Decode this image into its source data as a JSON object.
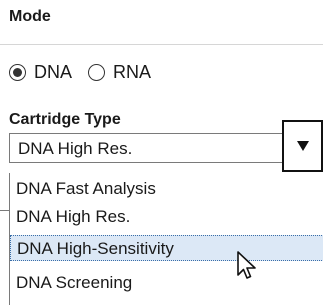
{
  "mode": {
    "title": "Mode",
    "options": [
      {
        "label": "DNA",
        "selected": true
      },
      {
        "label": "RNA",
        "selected": false
      }
    ]
  },
  "cartridge": {
    "label": "Cartridge Type",
    "selected_value": "DNA High Res.",
    "dropdown_icon": "triangle-down-icon",
    "options": [
      {
        "label": "DNA Fast Analysis"
      },
      {
        "label": "DNA High Res."
      },
      {
        "label": "DNA High-Sensitivity",
        "highlighted": true
      },
      {
        "label": "DNA Screening"
      }
    ]
  },
  "colors": {
    "highlight": "#dce8f6",
    "highlight_border": "#3a6ea8"
  }
}
